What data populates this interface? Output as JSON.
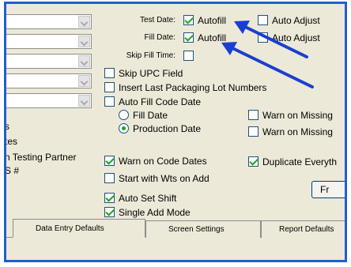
{
  "left_column": {
    "labels": [
      "s",
      "tes",
      "n Testing Partner",
      "S #"
    ]
  },
  "date_fields": {
    "test_date": {
      "label": "Test Date:",
      "autofill_label": "Autofill",
      "autofill_checked": true,
      "auto_adjust_label": "Auto Adjust",
      "auto_adjust_checked": false
    },
    "fill_date": {
      "label": "Fill Date:",
      "autofill_label": "Autofill",
      "autofill_checked": true,
      "auto_adjust_label": "Auto Adjust",
      "auto_adjust_checked": false
    },
    "skip_fill_time": {
      "label": "Skip Fill Time:",
      "checked": false
    }
  },
  "options": {
    "skip_upc": "Skip UPC Field",
    "insert_last_lot": "Insert Last Packaging Lot Numbers",
    "auto_fill_code_date": "Auto Fill Code Date",
    "fill_date_radio": "Fill Date",
    "production_date_radio": "Production Date",
    "warn_missing_1": "Warn on Missing",
    "warn_missing_2": "Warn on Missing",
    "warn_code_dates": "Warn on Code Dates",
    "duplicate_everything": "Duplicate Everyth",
    "start_with_wts": "Start with Wts on Add",
    "auto_set_shift": "Auto Set Shift",
    "single_add_mode": "Single Add Mode"
  },
  "button": {
    "label": "Fr"
  },
  "tabs": [
    {
      "label": "Data Entry Defaults",
      "active": true
    },
    {
      "label": "Screen Settings",
      "active": false
    },
    {
      "label": "Report Defaults",
      "active": false
    }
  ],
  "colors": {
    "frame": "#1f5fd0",
    "arrow": "#1a3fd0",
    "check": "#21a121",
    "panel": "#ece9d8"
  },
  "icons": [
    "dropdown-arrow-icon",
    "checkmark-icon",
    "arrow-annotation-icon"
  ]
}
